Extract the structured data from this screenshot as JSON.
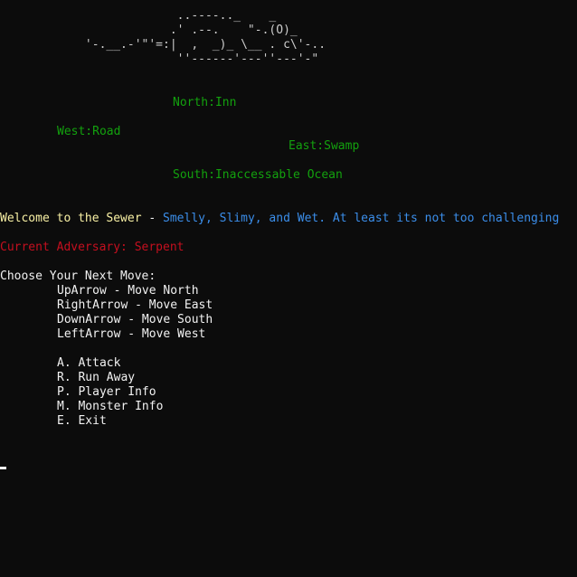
{
  "art": {
    "line1": "                         ..----.._    _",
    "line2": "                        .' .--.    \"-.(O)_",
    "line3": "            '-.__.-'\"'=:|  ,  _)_ \\__ . c\\'-..",
    "line4": "                         ''------'---''---'-\""
  },
  "directions": {
    "north": "North:Inn",
    "west": "West:Road",
    "east": "East:Swamp",
    "south": "South:Inaccessable Ocean"
  },
  "welcome": {
    "prefix": "Welcome to the Sewer",
    "separator": " - ",
    "description": "Smelly, Slimy, and Wet. At least its not too challenging"
  },
  "adversary": {
    "text": "Current Adversary: Serpent"
  },
  "menu": {
    "prompt": "Choose Your Next Move:",
    "moves": [
      "UpArrow - Move North",
      "RightArrow - Move East",
      "DownArrow - Move South",
      "LeftArrow - Move West"
    ],
    "actions": [
      "A. Attack",
      "R. Run Away",
      "P. Player Info",
      "M. Monster Info",
      "E. Exit"
    ]
  }
}
